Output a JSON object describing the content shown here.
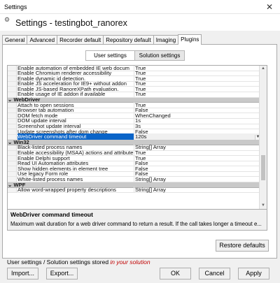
{
  "window": {
    "title": "Settings",
    "header": "Settings - testingbot_ranorex"
  },
  "tabs": [
    "General",
    "Advanced",
    "Recorder default",
    "Repository default",
    "Imaging",
    "Plugins"
  ],
  "active_tab": "Plugins",
  "segment": {
    "user": "User settings",
    "solution": "Solution settings"
  },
  "grid": {
    "rows": [
      {
        "type": "prop",
        "name": "Enable automation of embedded IE web docum",
        "value": "True"
      },
      {
        "type": "prop",
        "name": "Enable Chromium renderer accessibility",
        "value": "True"
      },
      {
        "type": "prop",
        "name": "Enable dynamic id detection.",
        "value": "True"
      },
      {
        "type": "prop",
        "name": "Enable JS acceleration for IE9+ without addon",
        "value": "True"
      },
      {
        "type": "prop",
        "name": "Enable JS-based RanoreXPath evaluation.",
        "value": "True"
      },
      {
        "type": "prop",
        "name": "Enable usage of IE addon if available",
        "value": "True"
      },
      {
        "type": "cat",
        "name": "WebDriver",
        "value": ""
      },
      {
        "type": "prop",
        "name": "Attach to open sessions",
        "value": "True"
      },
      {
        "type": "prop",
        "name": "Browser tab automation",
        "value": "False"
      },
      {
        "type": "prop",
        "name": "DOM fetch mode",
        "value": "WhenChanged"
      },
      {
        "type": "prop",
        "name": "DOM update interval",
        "value": "1s"
      },
      {
        "type": "prop",
        "name": "Screenshot update interval",
        "value": "3s"
      },
      {
        "type": "prop",
        "name": "Update screenshots after dom change",
        "value": "False"
      },
      {
        "type": "sel",
        "name": "WebDriver command timeout",
        "value": "120s"
      },
      {
        "type": "cat",
        "name": "Win32",
        "value": ""
      },
      {
        "type": "prop",
        "name": "Black-listed process names",
        "value": "String[] Array"
      },
      {
        "type": "prop",
        "name": "Enable accessibility (MSAA) actions and attribute",
        "value": "True"
      },
      {
        "type": "prop",
        "name": "Enable Delphi support",
        "value": "True"
      },
      {
        "type": "prop",
        "name": "Read UI Automation attributes",
        "value": "False"
      },
      {
        "type": "prop",
        "name": "Show hidden elements in element tree",
        "value": "False"
      },
      {
        "type": "prop",
        "name": "Use legacy Form role",
        "value": "False"
      },
      {
        "type": "prop",
        "name": "White-listed process names",
        "value": "String[] Array"
      },
      {
        "type": "cat",
        "name": "WPF",
        "value": ""
      },
      {
        "type": "prop",
        "name": "Allow word-wrapped property descriptions",
        "value": "String[] Array"
      }
    ]
  },
  "description": {
    "title": "WebDriver command timeout",
    "text": "Maximum wait duration for a web driver command to return a result. If the call takes longer a timeout e..."
  },
  "buttons": {
    "restore": "Restore defaults",
    "import": "Import...",
    "export": "Export...",
    "ok": "OK",
    "cancel": "Cancel",
    "apply": "Apply"
  },
  "status": {
    "prefix": "User settings / Solution settings stored ",
    "highlight": "in your solution"
  }
}
